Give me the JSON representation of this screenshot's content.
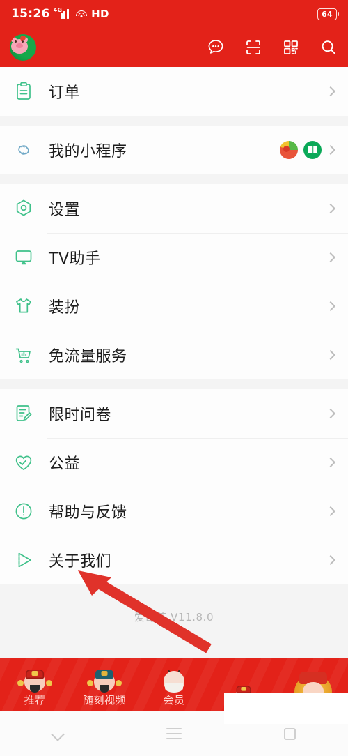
{
  "status_bar": {
    "time": "15:26",
    "network_label": "4G",
    "hd_label": "HD",
    "battery_level": "64"
  },
  "app_header": {
    "avatar_name": "user-avatar-pig",
    "actions": [
      {
        "name": "message-icon",
        "label": "消息"
      },
      {
        "name": "scan-icon",
        "label": "扫一扫"
      },
      {
        "name": "qrcode-icon",
        "label": "二维码"
      },
      {
        "name": "search-icon",
        "label": "搜索"
      }
    ]
  },
  "menu": {
    "groups": [
      {
        "items": [
          {
            "icon": "clipboard-icon",
            "label": "订单",
            "chevron": true,
            "badges": []
          }
        ]
      },
      {
        "items": [
          {
            "icon": "link-icon",
            "label": "我的小程序",
            "chevron": true,
            "badges": [
              {
                "name": "mini-program-fruit-icon"
              },
              {
                "name": "mini-program-book-icon"
              }
            ]
          }
        ]
      },
      {
        "items": [
          {
            "icon": "settings-hexagon-icon",
            "label": "设置",
            "chevron": true,
            "badges": []
          },
          {
            "icon": "tv-icon",
            "label": "TV助手",
            "chevron": true,
            "badges": []
          },
          {
            "icon": "tshirt-icon",
            "label": "装扮",
            "chevron": true,
            "badges": []
          },
          {
            "icon": "cart-icon",
            "label": "免流量服务",
            "chevron": true,
            "badges": []
          }
        ]
      },
      {
        "items": [
          {
            "icon": "survey-edit-icon",
            "label": "限时问卷",
            "chevron": true,
            "badges": []
          },
          {
            "icon": "heart-check-icon",
            "label": "公益",
            "chevron": true,
            "badges": []
          },
          {
            "icon": "help-circle-icon",
            "label": "帮助与反馈",
            "chevron": true,
            "badges": []
          },
          {
            "icon": "play-triangle-icon",
            "label": "关于我们",
            "chevron": true,
            "badges": []
          }
        ]
      }
    ]
  },
  "footer": {
    "version_text": "爱奇艺 V11.8.0"
  },
  "annotation": {
    "arrow_color": "#e0322a",
    "points_to": "关于我们"
  },
  "tab_bar": {
    "tabs": [
      {
        "name": "tab-recommend",
        "label": "推荐",
        "face": "god-red"
      },
      {
        "name": "tab-shuake-video",
        "label": "随刻视频",
        "face": "god-teal"
      },
      {
        "name": "tab-vip",
        "label": "会员",
        "face": "elder-white"
      },
      {
        "name": "tab-partial-1",
        "label": "",
        "face": "god-red-small"
      },
      {
        "name": "tab-partial-2",
        "label": "",
        "face": "god-gold"
      }
    ]
  },
  "system_nav": {
    "buttons": [
      {
        "name": "nav-back-button",
        "label": "返回"
      },
      {
        "name": "nav-menu-button",
        "label": "菜单"
      },
      {
        "name": "nav-recents-button",
        "label": "最近任务"
      }
    ]
  },
  "colors": {
    "brand_red": "#e32219",
    "icon_green": "#3fc18a",
    "list_bg": "#fdfdfd",
    "page_bg": "#f4f4f4"
  }
}
